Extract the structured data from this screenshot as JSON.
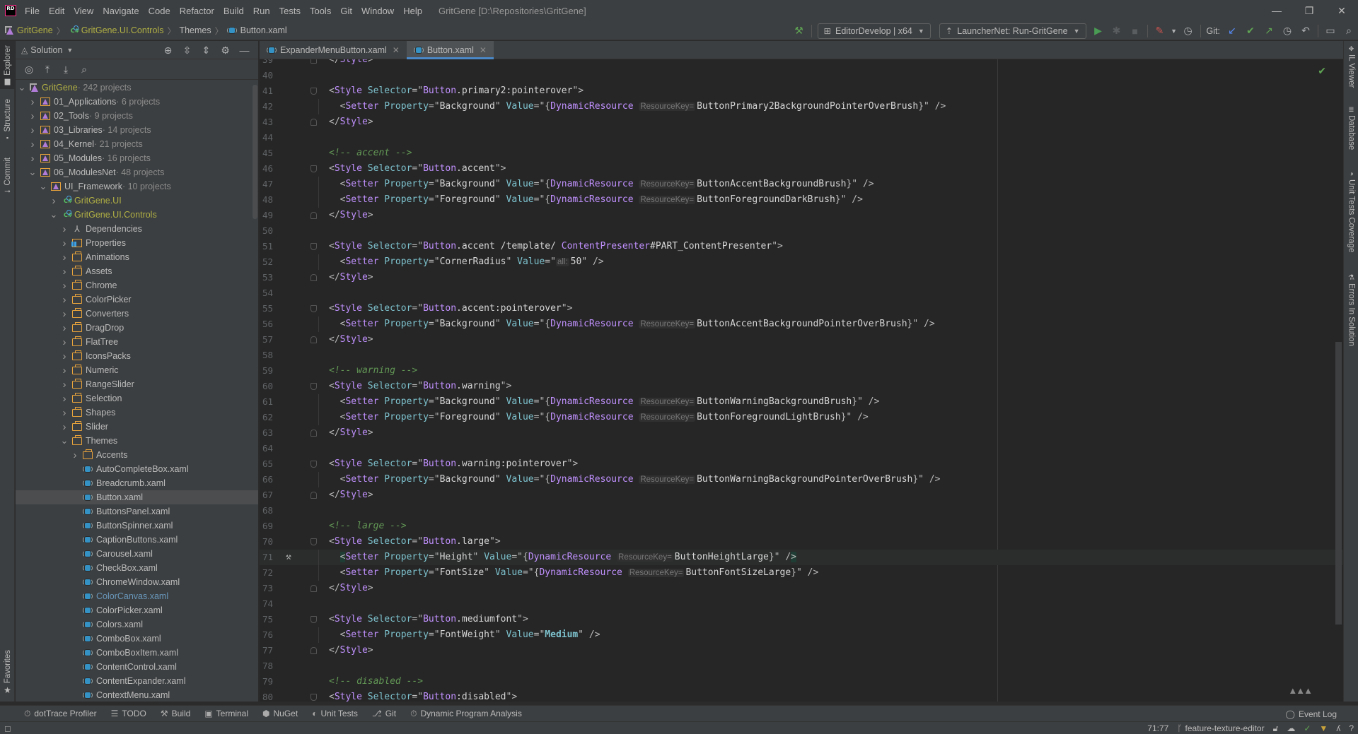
{
  "app": {
    "logo": "RD",
    "window_title": "GritGene [D:\\Repositories\\GritGene]",
    "menu": [
      "File",
      "Edit",
      "View",
      "Navigate",
      "Code",
      "Refactor",
      "Build",
      "Run",
      "Tests",
      "Tools",
      "Git",
      "Window",
      "Help"
    ],
    "window_controls": {
      "minimize": "—",
      "restore": "❐",
      "close": "✕"
    }
  },
  "breadcrumb": [
    {
      "label": "GritGene",
      "icon": "solution-icon"
    },
    {
      "label": "GritGene.UI.Controls",
      "icon": "csharp-project-icon"
    },
    {
      "label": "Themes",
      "icon": ""
    },
    {
      "label": "Button.xaml",
      "icon": "xaml-file-icon"
    }
  ],
  "toolbar": {
    "build_config": "EditorDevelop | x64",
    "run_config": "LauncherNet: Run-GritGene",
    "git_label": "Git:"
  },
  "left_strip": {
    "tabs": [
      "Explorer",
      "Structure",
      "Commit"
    ],
    "favorites": "Favorites"
  },
  "right_strip": {
    "tabs": [
      "IL Viewer",
      "Database",
      "Unit Tests Coverage",
      "Errors In Solution"
    ]
  },
  "explorer": {
    "title": "Solution",
    "tree": [
      {
        "depth": 0,
        "expanded": true,
        "icon": "solution",
        "label": "GritGene",
        "count": " · 242 projects",
        "style": "olive"
      },
      {
        "depth": 1,
        "expanded": false,
        "icon": "solfolder",
        "label": "01_Applications",
        "count": " · 6 projects"
      },
      {
        "depth": 1,
        "expanded": false,
        "icon": "solfolder",
        "label": "02_Tools",
        "count": " · 9 projects"
      },
      {
        "depth": 1,
        "expanded": false,
        "icon": "solfolder",
        "label": "03_Libraries",
        "count": " · 14 projects"
      },
      {
        "depth": 1,
        "expanded": false,
        "icon": "solfolder",
        "label": "04_Kernel",
        "count": " · 21 projects"
      },
      {
        "depth": 1,
        "expanded": false,
        "icon": "solfolder",
        "label": "05_Modules",
        "count": " · 16 projects"
      },
      {
        "depth": 1,
        "expanded": true,
        "icon": "solfolder",
        "label": "06_ModulesNet",
        "count": " · 48 projects"
      },
      {
        "depth": 2,
        "expanded": true,
        "icon": "solfolder",
        "label": "UI_Framework",
        "count": " · 10 projects"
      },
      {
        "depth": 3,
        "expanded": false,
        "icon": "csproj",
        "label": "GritGene.UI",
        "count": "",
        "style": "olive"
      },
      {
        "depth": 3,
        "expanded": true,
        "icon": "csproj",
        "label": "GritGene.UI.Controls",
        "count": "",
        "style": "olive"
      },
      {
        "depth": 4,
        "expanded": false,
        "icon": "deps",
        "label": "Dependencies",
        "count": ""
      },
      {
        "depth": 4,
        "expanded": false,
        "icon": "props",
        "label": "Properties",
        "count": ""
      },
      {
        "depth": 4,
        "expanded": false,
        "icon": "folder",
        "label": "Animations",
        "count": ""
      },
      {
        "depth": 4,
        "expanded": false,
        "icon": "folder",
        "label": "Assets",
        "count": ""
      },
      {
        "depth": 4,
        "expanded": false,
        "icon": "folder",
        "label": "Chrome",
        "count": ""
      },
      {
        "depth": 4,
        "expanded": false,
        "icon": "folder",
        "label": "ColorPicker",
        "count": ""
      },
      {
        "depth": 4,
        "expanded": false,
        "icon": "folder",
        "label": "Converters",
        "count": ""
      },
      {
        "depth": 4,
        "expanded": false,
        "icon": "folder",
        "label": "DragDrop",
        "count": ""
      },
      {
        "depth": 4,
        "expanded": false,
        "icon": "folder",
        "label": "FlatTree",
        "count": ""
      },
      {
        "depth": 4,
        "expanded": false,
        "icon": "folder",
        "label": "IconsPacks",
        "count": ""
      },
      {
        "depth": 4,
        "expanded": false,
        "icon": "folder",
        "label": "Numeric",
        "count": ""
      },
      {
        "depth": 4,
        "expanded": false,
        "icon": "folder",
        "label": "RangeSlider",
        "count": ""
      },
      {
        "depth": 4,
        "expanded": false,
        "icon": "folder",
        "label": "Selection",
        "count": ""
      },
      {
        "depth": 4,
        "expanded": false,
        "icon": "folder",
        "label": "Shapes",
        "count": ""
      },
      {
        "depth": 4,
        "expanded": false,
        "icon": "folder",
        "label": "Slider",
        "count": ""
      },
      {
        "depth": 4,
        "expanded": true,
        "icon": "folder",
        "label": "Themes",
        "count": ""
      },
      {
        "depth": 5,
        "expanded": false,
        "icon": "folder",
        "label": "Accents",
        "count": ""
      },
      {
        "depth": 5,
        "leaf": true,
        "icon": "xaml",
        "label": "AutoCompleteBox.xaml",
        "count": ""
      },
      {
        "depth": 5,
        "leaf": true,
        "icon": "xaml",
        "label": "Breadcrumb.xaml",
        "count": ""
      },
      {
        "depth": 5,
        "leaf": true,
        "icon": "xaml",
        "label": "Button.xaml",
        "count": "",
        "selected": true
      },
      {
        "depth": 5,
        "leaf": true,
        "icon": "xaml",
        "label": "ButtonsPanel.xaml",
        "count": ""
      },
      {
        "depth": 5,
        "leaf": true,
        "icon": "xaml",
        "label": "ButtonSpinner.xaml",
        "count": ""
      },
      {
        "depth": 5,
        "leaf": true,
        "icon": "xaml",
        "label": "CaptionButtons.xaml",
        "count": ""
      },
      {
        "depth": 5,
        "leaf": true,
        "icon": "xaml",
        "label": "Carousel.xaml",
        "count": ""
      },
      {
        "depth": 5,
        "leaf": true,
        "icon": "xaml",
        "label": "CheckBox.xaml",
        "count": ""
      },
      {
        "depth": 5,
        "leaf": true,
        "icon": "xaml",
        "label": "ChromeWindow.xaml",
        "count": ""
      },
      {
        "depth": 5,
        "leaf": true,
        "icon": "xaml",
        "label": "ColorCanvas.xaml",
        "count": "",
        "style": "blue"
      },
      {
        "depth": 5,
        "leaf": true,
        "icon": "xaml",
        "label": "ColorPicker.xaml",
        "count": ""
      },
      {
        "depth": 5,
        "leaf": true,
        "icon": "xaml",
        "label": "Colors.xaml",
        "count": ""
      },
      {
        "depth": 5,
        "leaf": true,
        "icon": "xaml",
        "label": "ComboBox.xaml",
        "count": ""
      },
      {
        "depth": 5,
        "leaf": true,
        "icon": "xaml",
        "label": "ComboBoxItem.xaml",
        "count": ""
      },
      {
        "depth": 5,
        "leaf": true,
        "icon": "xaml",
        "label": "ContentControl.xaml",
        "count": ""
      },
      {
        "depth": 5,
        "leaf": true,
        "icon": "xaml",
        "label": "ContentExpander.xaml",
        "count": ""
      },
      {
        "depth": 5,
        "leaf": true,
        "icon": "xaml",
        "label": "ContextMenu.xaml",
        "count": ""
      }
    ]
  },
  "editor": {
    "tabs": [
      {
        "label": "ExpanderMenuButton.xaml",
        "active": false
      },
      {
        "label": "Button.xaml",
        "active": true
      }
    ],
    "current_line": 71,
    "lines": [
      {
        "n": 39,
        "kind": "close",
        "indent": 0
      },
      {
        "n": 40,
        "kind": "blank"
      },
      {
        "n": 41,
        "kind": "style",
        "indent": 0,
        "sel_type": "Button",
        "sel_rest": ".primary2:pointerover"
      },
      {
        "n": 42,
        "kind": "setter",
        "indent": 1,
        "prop": "Background",
        "ext": "DynamicResource",
        "hint": "ResourceKey=",
        "key": "ButtonPrimary2BackgroundPointerOverBrush"
      },
      {
        "n": 43,
        "kind": "close",
        "indent": 0
      },
      {
        "n": 44,
        "kind": "blank"
      },
      {
        "n": 45,
        "kind": "comment",
        "text": "accent"
      },
      {
        "n": 46,
        "kind": "style",
        "indent": 0,
        "sel_type": "Button",
        "sel_rest": ".accent"
      },
      {
        "n": 47,
        "kind": "setter",
        "indent": 1,
        "prop": "Background",
        "ext": "DynamicResource",
        "hint": "ResourceKey=",
        "key": "ButtonAccentBackgroundBrush"
      },
      {
        "n": 48,
        "kind": "setter",
        "indent": 1,
        "prop": "Foreground",
        "ext": "DynamicResource",
        "hint": "ResourceKey=",
        "key": "ButtonForegroundDarkBrush"
      },
      {
        "n": 49,
        "kind": "close",
        "indent": 0
      },
      {
        "n": 50,
        "kind": "blank"
      },
      {
        "n": 51,
        "kind": "style",
        "indent": 0,
        "sel_type": "Button",
        "sel_rest": ".accent /template/ ",
        "sel_type2": "ContentPresenter",
        "sel_rest2": "#PART_ContentPresenter"
      },
      {
        "n": 52,
        "kind": "setter-plain",
        "indent": 1,
        "prop": "CornerRadius",
        "hint": "all:",
        "value": "50"
      },
      {
        "n": 53,
        "kind": "close",
        "indent": 0
      },
      {
        "n": 54,
        "kind": "blank"
      },
      {
        "n": 55,
        "kind": "style",
        "indent": 0,
        "sel_type": "Button",
        "sel_rest": ".accent:pointerover"
      },
      {
        "n": 56,
        "kind": "setter",
        "indent": 1,
        "prop": "Background",
        "ext": "DynamicResource",
        "hint": "ResourceKey=",
        "key": "ButtonAccentBackgroundPointerOverBrush"
      },
      {
        "n": 57,
        "kind": "close",
        "indent": 0
      },
      {
        "n": 58,
        "kind": "blank"
      },
      {
        "n": 59,
        "kind": "comment",
        "text": "warning"
      },
      {
        "n": 60,
        "kind": "style",
        "indent": 0,
        "sel_type": "Button",
        "sel_rest": ".warning"
      },
      {
        "n": 61,
        "kind": "setter",
        "indent": 1,
        "prop": "Background",
        "ext": "DynamicResource",
        "hint": "ResourceKey=",
        "key": "ButtonWarningBackgroundBrush"
      },
      {
        "n": 62,
        "kind": "setter",
        "indent": 1,
        "prop": "Foreground",
        "ext": "DynamicResource",
        "hint": "ResourceKey=",
        "key": "ButtonForegroundLightBrush"
      },
      {
        "n": 63,
        "kind": "close",
        "indent": 0
      },
      {
        "n": 64,
        "kind": "blank"
      },
      {
        "n": 65,
        "kind": "style",
        "indent": 0,
        "sel_type": "Button",
        "sel_rest": ".warning:pointerover"
      },
      {
        "n": 66,
        "kind": "setter",
        "indent": 1,
        "prop": "Background",
        "ext": "DynamicResource",
        "hint": "ResourceKey=",
        "key": "ButtonWarningBackgroundPointerOverBrush"
      },
      {
        "n": 67,
        "kind": "close",
        "indent": 0
      },
      {
        "n": 68,
        "kind": "blank"
      },
      {
        "n": 69,
        "kind": "comment",
        "text": "large"
      },
      {
        "n": 70,
        "kind": "style",
        "indent": 0,
        "sel_type": "Button",
        "sel_rest": ".large"
      },
      {
        "n": 71,
        "kind": "setter",
        "indent": 1,
        "prop": "Height",
        "ext": "DynamicResource",
        "hint": "ResourceKey=",
        "key": "ButtonHeightLarge",
        "gutter_icon": "hammer"
      },
      {
        "n": 72,
        "kind": "setter",
        "indent": 1,
        "prop": "FontSize",
        "ext": "DynamicResource",
        "hint": "ResourceKey=",
        "key": "ButtonFontSizeLarge"
      },
      {
        "n": 73,
        "kind": "close",
        "indent": 0
      },
      {
        "n": 74,
        "kind": "blank"
      },
      {
        "n": 75,
        "kind": "style",
        "indent": 0,
        "sel_type": "Button",
        "sel_rest": ".mediumfont"
      },
      {
        "n": 76,
        "kind": "setter-bold",
        "indent": 1,
        "prop": "FontWeight",
        "value": "Medium"
      },
      {
        "n": 77,
        "kind": "close",
        "indent": 0
      },
      {
        "n": 78,
        "kind": "blank"
      },
      {
        "n": 79,
        "kind": "comment",
        "text": "disabled"
      },
      {
        "n": 80,
        "kind": "style",
        "indent": 0,
        "sel_type": "Button",
        "sel_rest": ":disabled"
      }
    ]
  },
  "bottom_tools": [
    {
      "icon": "⏱",
      "label": "dotTrace Profiler"
    },
    {
      "icon": "☰",
      "label": "TODO"
    },
    {
      "icon": "⚒",
      "label": "Build"
    },
    {
      "icon": "▣",
      "label": "Terminal"
    },
    {
      "icon": "⬢",
      "label": "NuGet"
    },
    {
      "icon": "◐",
      "label": "Unit Tests"
    },
    {
      "icon": "⎇",
      "label": "Git"
    },
    {
      "icon": "⏱",
      "label": "Dynamic Program Analysis"
    }
  ],
  "event_log": "Event Log",
  "status": {
    "position": "71:77",
    "branch": "feature-texture-editor"
  }
}
